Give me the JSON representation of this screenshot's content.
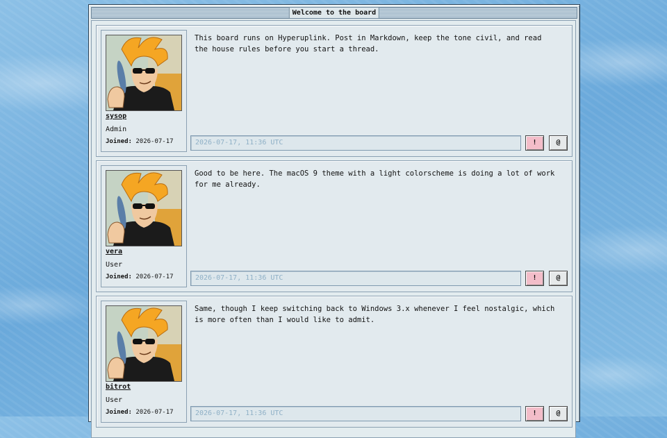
{
  "window": {
    "title": "Welcome to the board"
  },
  "posts": [
    {
      "username": "sysop",
      "role": "Admin",
      "joined_label": "Joined:",
      "joined_date": "2026-07-17",
      "body": "This board runs on Hyperuplink. Post in Markdown, keep the tone civil, and read the house rules before you start a thread.",
      "timestamp": "2026-07-17, 11:36 UTC",
      "report_label": "!",
      "mention_label": "@"
    },
    {
      "username": "vera",
      "role": "User",
      "joined_label": "Joined:",
      "joined_date": "2026-07-17",
      "body": "Good to be here. The macOS 9 theme with a light colorscheme is doing a lot of work for me already.",
      "timestamp": "2026-07-17, 11:36 UTC",
      "report_label": "!",
      "mention_label": "@"
    },
    {
      "username": "bitrot",
      "role": "User",
      "joined_label": "Joined:",
      "joined_date": "2026-07-17",
      "body": "Same, though I keep switching back to Windows 3.x whenever I feel nostalgic, which is more often than I would like to admit.",
      "timestamp": "2026-07-17, 11:36 UTC",
      "report_label": "!",
      "mention_label": "@"
    }
  ],
  "colors": {
    "background": "#7fb6e0",
    "report_button": "#f3bdc9",
    "timestamp_text": "#8fb0c6"
  },
  "icons": {
    "avatar": "cartoon-avatar-with-sunglasses"
  }
}
